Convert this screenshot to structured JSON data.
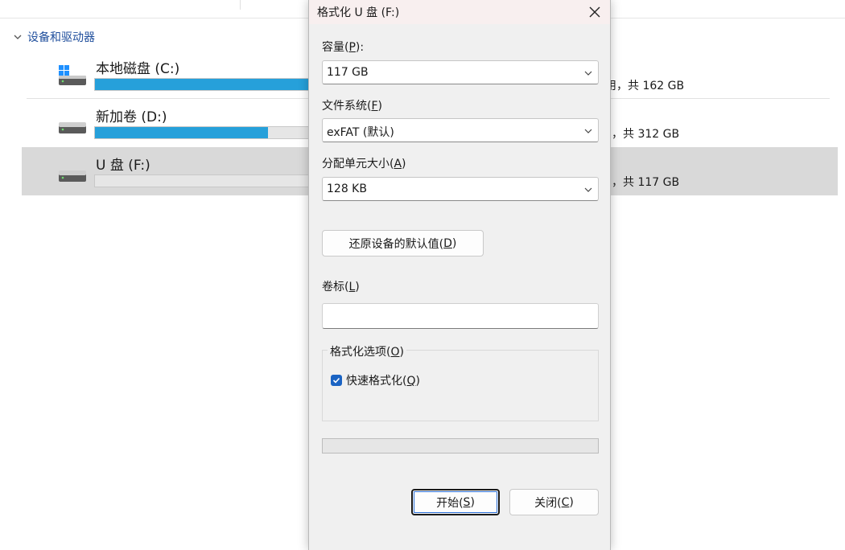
{
  "explorer": {
    "group_header": "设备和驱动器",
    "drives": [
      {
        "name": "本地磁盘 (C:)",
        "space_tail": "用，共 162 GB",
        "fill_fraction": 0.8,
        "selected": false,
        "icon": "windows-drive-icon"
      },
      {
        "name": "新加卷 (D:)",
        "space_tail": "，共 312 GB",
        "fill_fraction": 0.6,
        "selected": false,
        "icon": "hard-drive-icon"
      },
      {
        "name": "U 盘 (F:)",
        "space_tail": "，共 117 GB",
        "fill_fraction": 0.0,
        "selected": true,
        "icon": "hard-drive-icon"
      }
    ]
  },
  "dialog": {
    "title": "格式化 U 盘 (F:)",
    "capacity": {
      "label_pre": "容量(",
      "key": "P",
      "label_post": "):",
      "value": "117 GB"
    },
    "filesystem": {
      "label_pre": "文件系统(",
      "key": "F",
      "label_post": ")",
      "value": "exFAT (默认)"
    },
    "allocation": {
      "label_pre": "分配单元大小(",
      "key": "A",
      "label_post": ")",
      "value": "128 KB"
    },
    "restore": {
      "label_pre": "还原设备的默认值(",
      "key": "D",
      "label_post": ")"
    },
    "volume": {
      "label_pre": "卷标(",
      "key": "L",
      "label_post": ")",
      "value": ""
    },
    "options": {
      "legend_pre": "格式化选项(",
      "key": "O",
      "legend_post": ")"
    },
    "quick_format": {
      "label_pre": "快速格式化(",
      "key": "Q",
      "label_post": ")",
      "checked": true
    },
    "progress_fraction": 0.0,
    "start": {
      "label_pre": "开始(",
      "key": "S",
      "label_post": ")"
    },
    "close": {
      "label_pre": "关闭(",
      "key": "C",
      "label_post": ")"
    }
  },
  "colors": {
    "accent": "#26a0da",
    "checkbox": "#1a63c3",
    "link": "#1f4e9c",
    "selected_row": "#d9d9d9"
  }
}
